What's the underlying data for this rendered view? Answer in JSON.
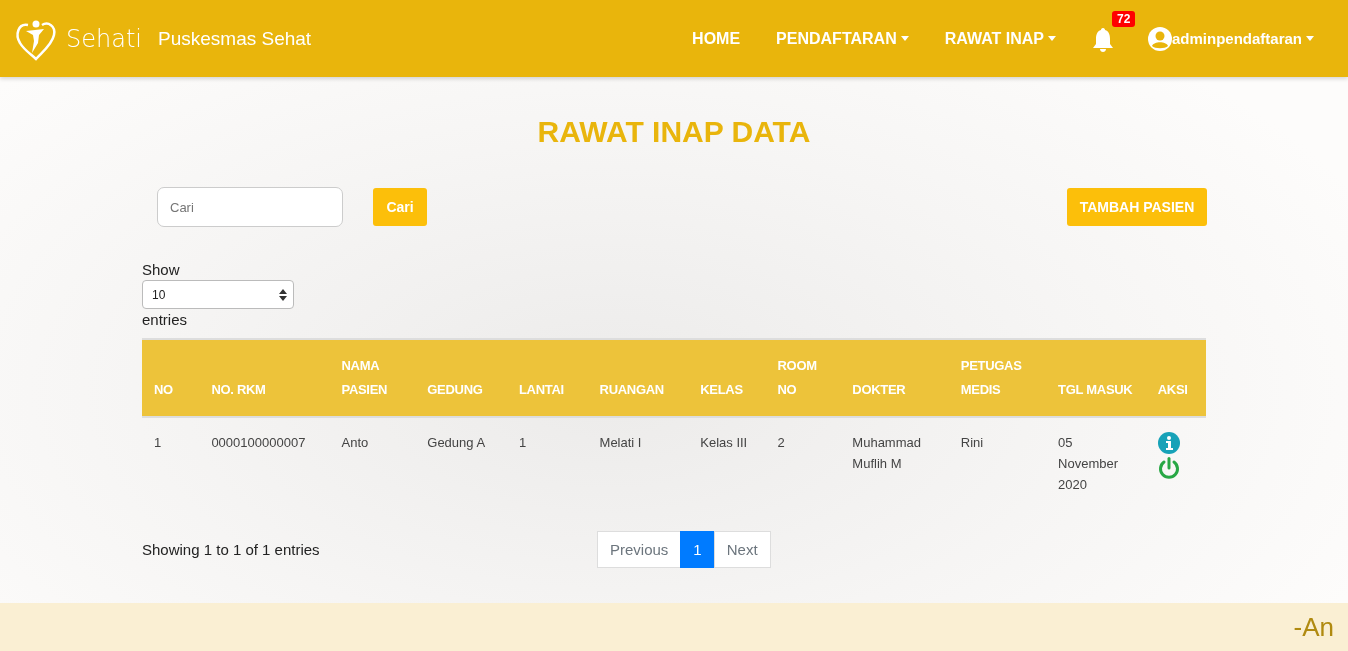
{
  "navbar": {
    "logo_text": "Sehati",
    "site_name": "Puskesmas Sehat",
    "menu": [
      {
        "label": "HOME",
        "dropdown": false
      },
      {
        "label": "PENDAFTARAN",
        "dropdown": true
      },
      {
        "label": "RAWAT INAP",
        "dropdown": true
      }
    ],
    "notification_count": "72",
    "user": "adminpendaftaran"
  },
  "page_title": "RAWAT INAP DATA",
  "search": {
    "placeholder": "Cari",
    "button": "Cari"
  },
  "add_button": "TAMBAH PASIEN",
  "length": {
    "before": "Show",
    "value": "10",
    "after": "entries"
  },
  "table": {
    "columns": [
      "NO",
      "NO. RKM",
      "NAMA PASIEN",
      "GEDUNG",
      "LANTAI",
      "RUANGAN",
      "KELAS",
      "ROOM NO",
      "DOKTER",
      "PETUGAS MEDIS",
      "TGL MASUK",
      "AKSI"
    ],
    "rows": [
      {
        "cells": [
          "1",
          "0000100000007",
          "Anto",
          "Gedung A",
          "1",
          "Melati I",
          "Kelas III",
          "2",
          "Muhammad Muflih M",
          "Rini",
          "05 November 2020"
        ]
      }
    ]
  },
  "info": "Showing 1 to 1 of 1 entries",
  "pagination": {
    "previous": "Previous",
    "pages": [
      {
        "label": "1",
        "selected": true
      }
    ],
    "next": "Next"
  },
  "footer_text": "-An"
}
